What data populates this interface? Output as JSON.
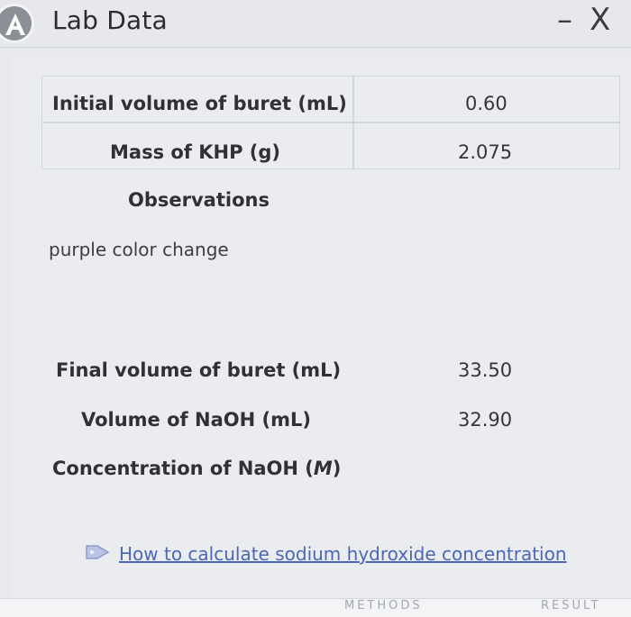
{
  "window": {
    "title": "Lab Data",
    "badge_letter": "A",
    "minimize_glyph": "–",
    "close_glyph": "X"
  },
  "rows": [
    {
      "label": "Initial volume of buret (mL)",
      "value": "0.60"
    },
    {
      "label": "Mass of KHP (g)",
      "value": "2.075"
    },
    {
      "label": "Observations",
      "value": ""
    },
    {
      "label": "Final volume of buret (mL)",
      "value": "33.50"
    },
    {
      "label": "Volume of NaOH (mL)",
      "value": "32.90"
    },
    {
      "label": "Concentration of NaOH (M)",
      "value": ""
    }
  ],
  "observations_text": "purple color change",
  "help_link": {
    "label": "How to calculate sodium hydroxide concentration",
    "icon": "tag-icon"
  },
  "footer": {
    "left_text": "METHODS",
    "right_text": "RESULT"
  },
  "colors": {
    "link": "#4a67b8",
    "label": "#2f3136"
  }
}
